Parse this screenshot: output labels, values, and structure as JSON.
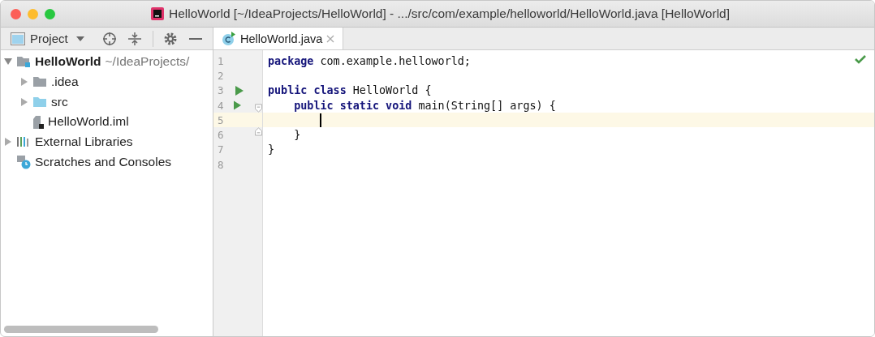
{
  "window": {
    "title": "HelloWorld [~/IdeaProjects/HelloWorld] - .../src/com/example/helloworld/HelloWorld.java [HelloWorld]"
  },
  "project_panel": {
    "title": "Project",
    "tree": [
      {
        "label": "HelloWorld",
        "detail": "~/IdeaProjects/",
        "kind": "module",
        "expanded": true,
        "children": [
          {
            "label": ".idea",
            "kind": "folder",
            "expanded": false
          },
          {
            "label": "src",
            "kind": "source-folder",
            "expanded": false
          },
          {
            "label": "HelloWorld.iml",
            "kind": "file"
          }
        ]
      },
      {
        "label": "External Libraries",
        "kind": "libraries",
        "expanded": false
      },
      {
        "label": "Scratches and Consoles",
        "kind": "scratches"
      }
    ]
  },
  "tabs": [
    {
      "label": "HelloWorld.java",
      "selected": true
    }
  ],
  "editor": {
    "inspection_ok": true,
    "lines": [
      {
        "number": "1",
        "current": false,
        "run_marker": false,
        "fold_start": false,
        "fold_end": false,
        "tokens": [
          {
            "text": "package",
            "kind": "keyword"
          },
          {
            "text": " com.example.helloworld;",
            "kind": "plain"
          }
        ]
      },
      {
        "number": "2",
        "current": false,
        "run_marker": false,
        "fold_start": false,
        "fold_end": false
      },
      {
        "number": "3",
        "current": false,
        "run_marker": true,
        "fold_start": false,
        "fold_end": false,
        "tokens": [
          {
            "text": "public class",
            "kind": "keyword"
          },
          {
            "text": " HelloWorld {",
            "kind": "plain"
          }
        ]
      },
      {
        "number": "4",
        "current": false,
        "run_marker": true,
        "fold_start": true,
        "fold_end": false,
        "tokens": [
          {
            "text": "    public static void",
            "kind": "keyword"
          },
          {
            "text": " main(String[] args) {",
            "kind": "plain"
          }
        ]
      },
      {
        "number": "5",
        "current": true,
        "caret": true,
        "run_marker": false,
        "fold_start": false,
        "fold_end": false
      },
      {
        "number": "6",
        "current": false,
        "run_marker": false,
        "fold_start": false,
        "fold_end": true,
        "tokens": [
          {
            "text": "    }",
            "kind": "plain"
          }
        ]
      },
      {
        "number": "7",
        "current": false,
        "run_marker": false,
        "fold_start": false,
        "fold_end": false,
        "tokens": [
          {
            "text": "}",
            "kind": "plain"
          }
        ]
      },
      {
        "number": "8",
        "current": false,
        "run_marker": false,
        "fold_start": false,
        "fold_end": false
      }
    ]
  }
}
